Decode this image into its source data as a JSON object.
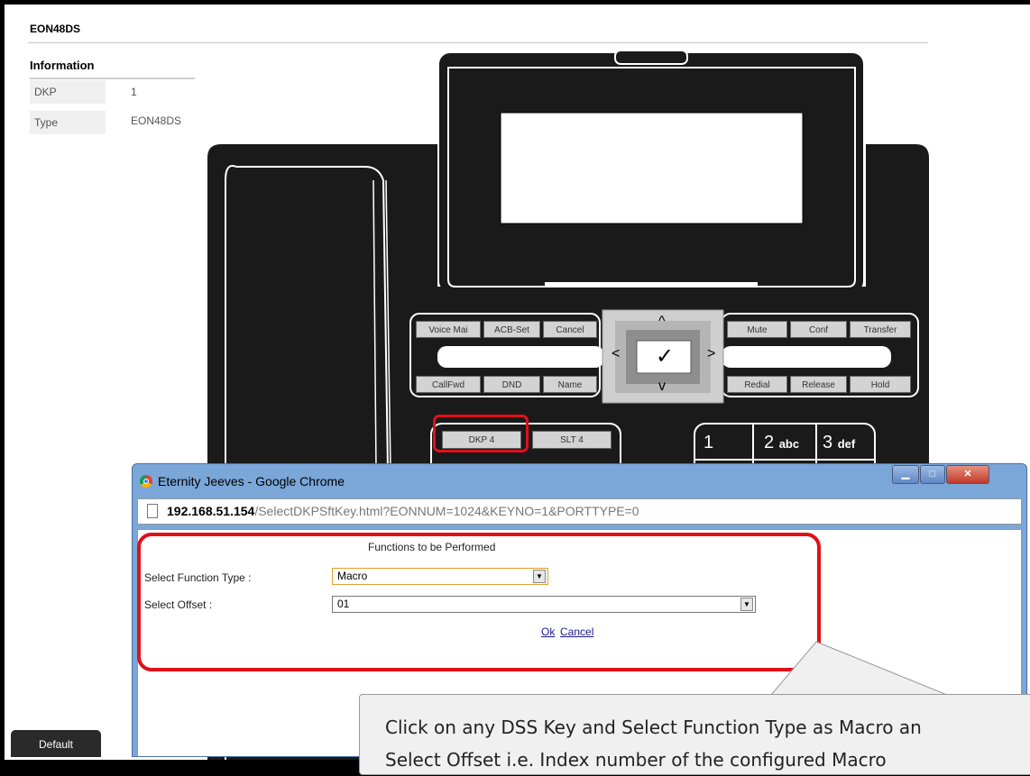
{
  "page": {
    "title": "EON48DS",
    "info_heading": "Information",
    "info_rows": [
      {
        "label": "DKP",
        "value": "1"
      },
      {
        "label": "Type",
        "value": "EON48DS"
      }
    ],
    "default_button": "Default"
  },
  "phone": {
    "top_keys": [
      "Voice Mai",
      "ACB-Set",
      "Cancel"
    ],
    "bottom_keys": [
      "CallFwd",
      "DND",
      "Name"
    ],
    "right_top_keys": [
      "Mute",
      "Conf",
      "Transfer"
    ],
    "right_bottom_keys": [
      "Redial",
      "Release",
      "Hold"
    ],
    "nav": {
      "up": "^",
      "down": "v",
      "left": "<",
      "right": ">",
      "ok": "✓"
    },
    "dss_keys": [
      "DKP 4",
      "SLT 4"
    ],
    "keypad": [
      {
        "digit": "1",
        "letters": ""
      },
      {
        "digit": "2",
        "letters": "abc"
      },
      {
        "digit": "3",
        "letters": "def"
      }
    ]
  },
  "popup": {
    "window_title": "Eternity Jeeves - Google Chrome",
    "address_host": "192.168.51.154",
    "address_path": "/SelectDKPSftKey.html?EONNUM=1024&KEYNO=1&PORTTYPE=0",
    "form_title": "Functions to be Performed",
    "function_type_label": "Select Function Type :",
    "function_type_value": "Macro",
    "offset_label": "Select Offset :",
    "offset_value": "01",
    "ok_link": "Ok",
    "cancel_link": "Cancel"
  },
  "callout": {
    "line1": "Click on any DSS Key and Select Function Type as Macro an",
    "line2": "Select Offset i.e. Index number of the configured Macro"
  },
  "colors": {
    "highlight": "#e0101a",
    "phone_body": "#1a1a1a",
    "chrome_frame": "#7ba6d8"
  }
}
